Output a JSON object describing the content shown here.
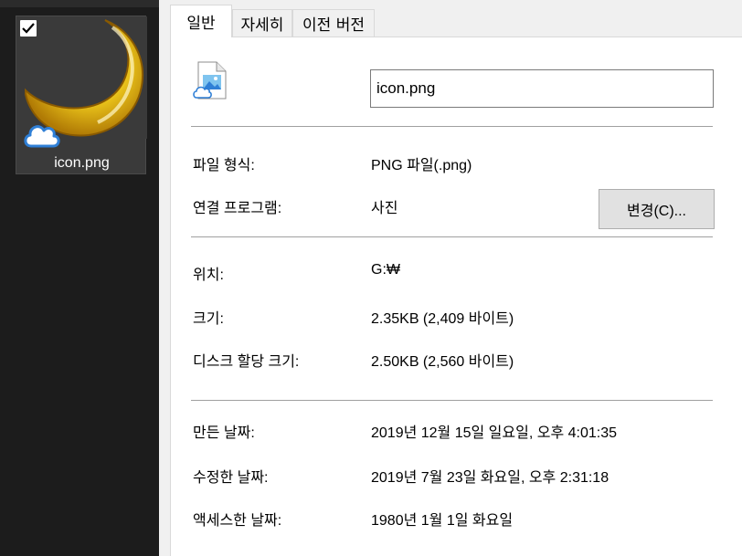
{
  "explorer": {
    "file_name": "icon.png",
    "checked": true
  },
  "tabs": [
    {
      "label": "일반",
      "active": true
    },
    {
      "label": "자세히",
      "active": false
    },
    {
      "label": "이전 버전",
      "active": false
    }
  ],
  "general": {
    "file_name_value": "icon.png",
    "file_type_label": "파일 형식:",
    "file_type_value": "PNG 파일(.png)",
    "opens_with_label": "연결 프로그램:",
    "opens_with_value": "사진",
    "change_button_label": "변경(C)...",
    "location_label": "위치:",
    "location_value": "G:₩",
    "size_label": "크기:",
    "size_value": "2.35KB (2,409 바이트)",
    "size_on_disk_label": "디스크 할당 크기:",
    "size_on_disk_value": "2.50KB (2,560 바이트)",
    "created_label": "만든 날짜:",
    "created_value": "2019년 12월 15일 일요일, 오후 4:01:35",
    "modified_label": "수정한 날짜:",
    "modified_value": "2019년 7월 23일 화요일, 오후 2:31:18",
    "accessed_label": "액세스한 날짜:",
    "accessed_value": "1980년 1월 1일 화요일"
  },
  "colors": {
    "explorer_bg": "#1c1c1c",
    "panel_bg": "#f0f0f0",
    "cloud_blue": "#2f7fd6",
    "moon_gold": "#f2c21a"
  },
  "icons": [
    "checkbox-check-icon",
    "crescent-moon-thumbnail",
    "cloud-sync-icon",
    "image-file-icon"
  ]
}
